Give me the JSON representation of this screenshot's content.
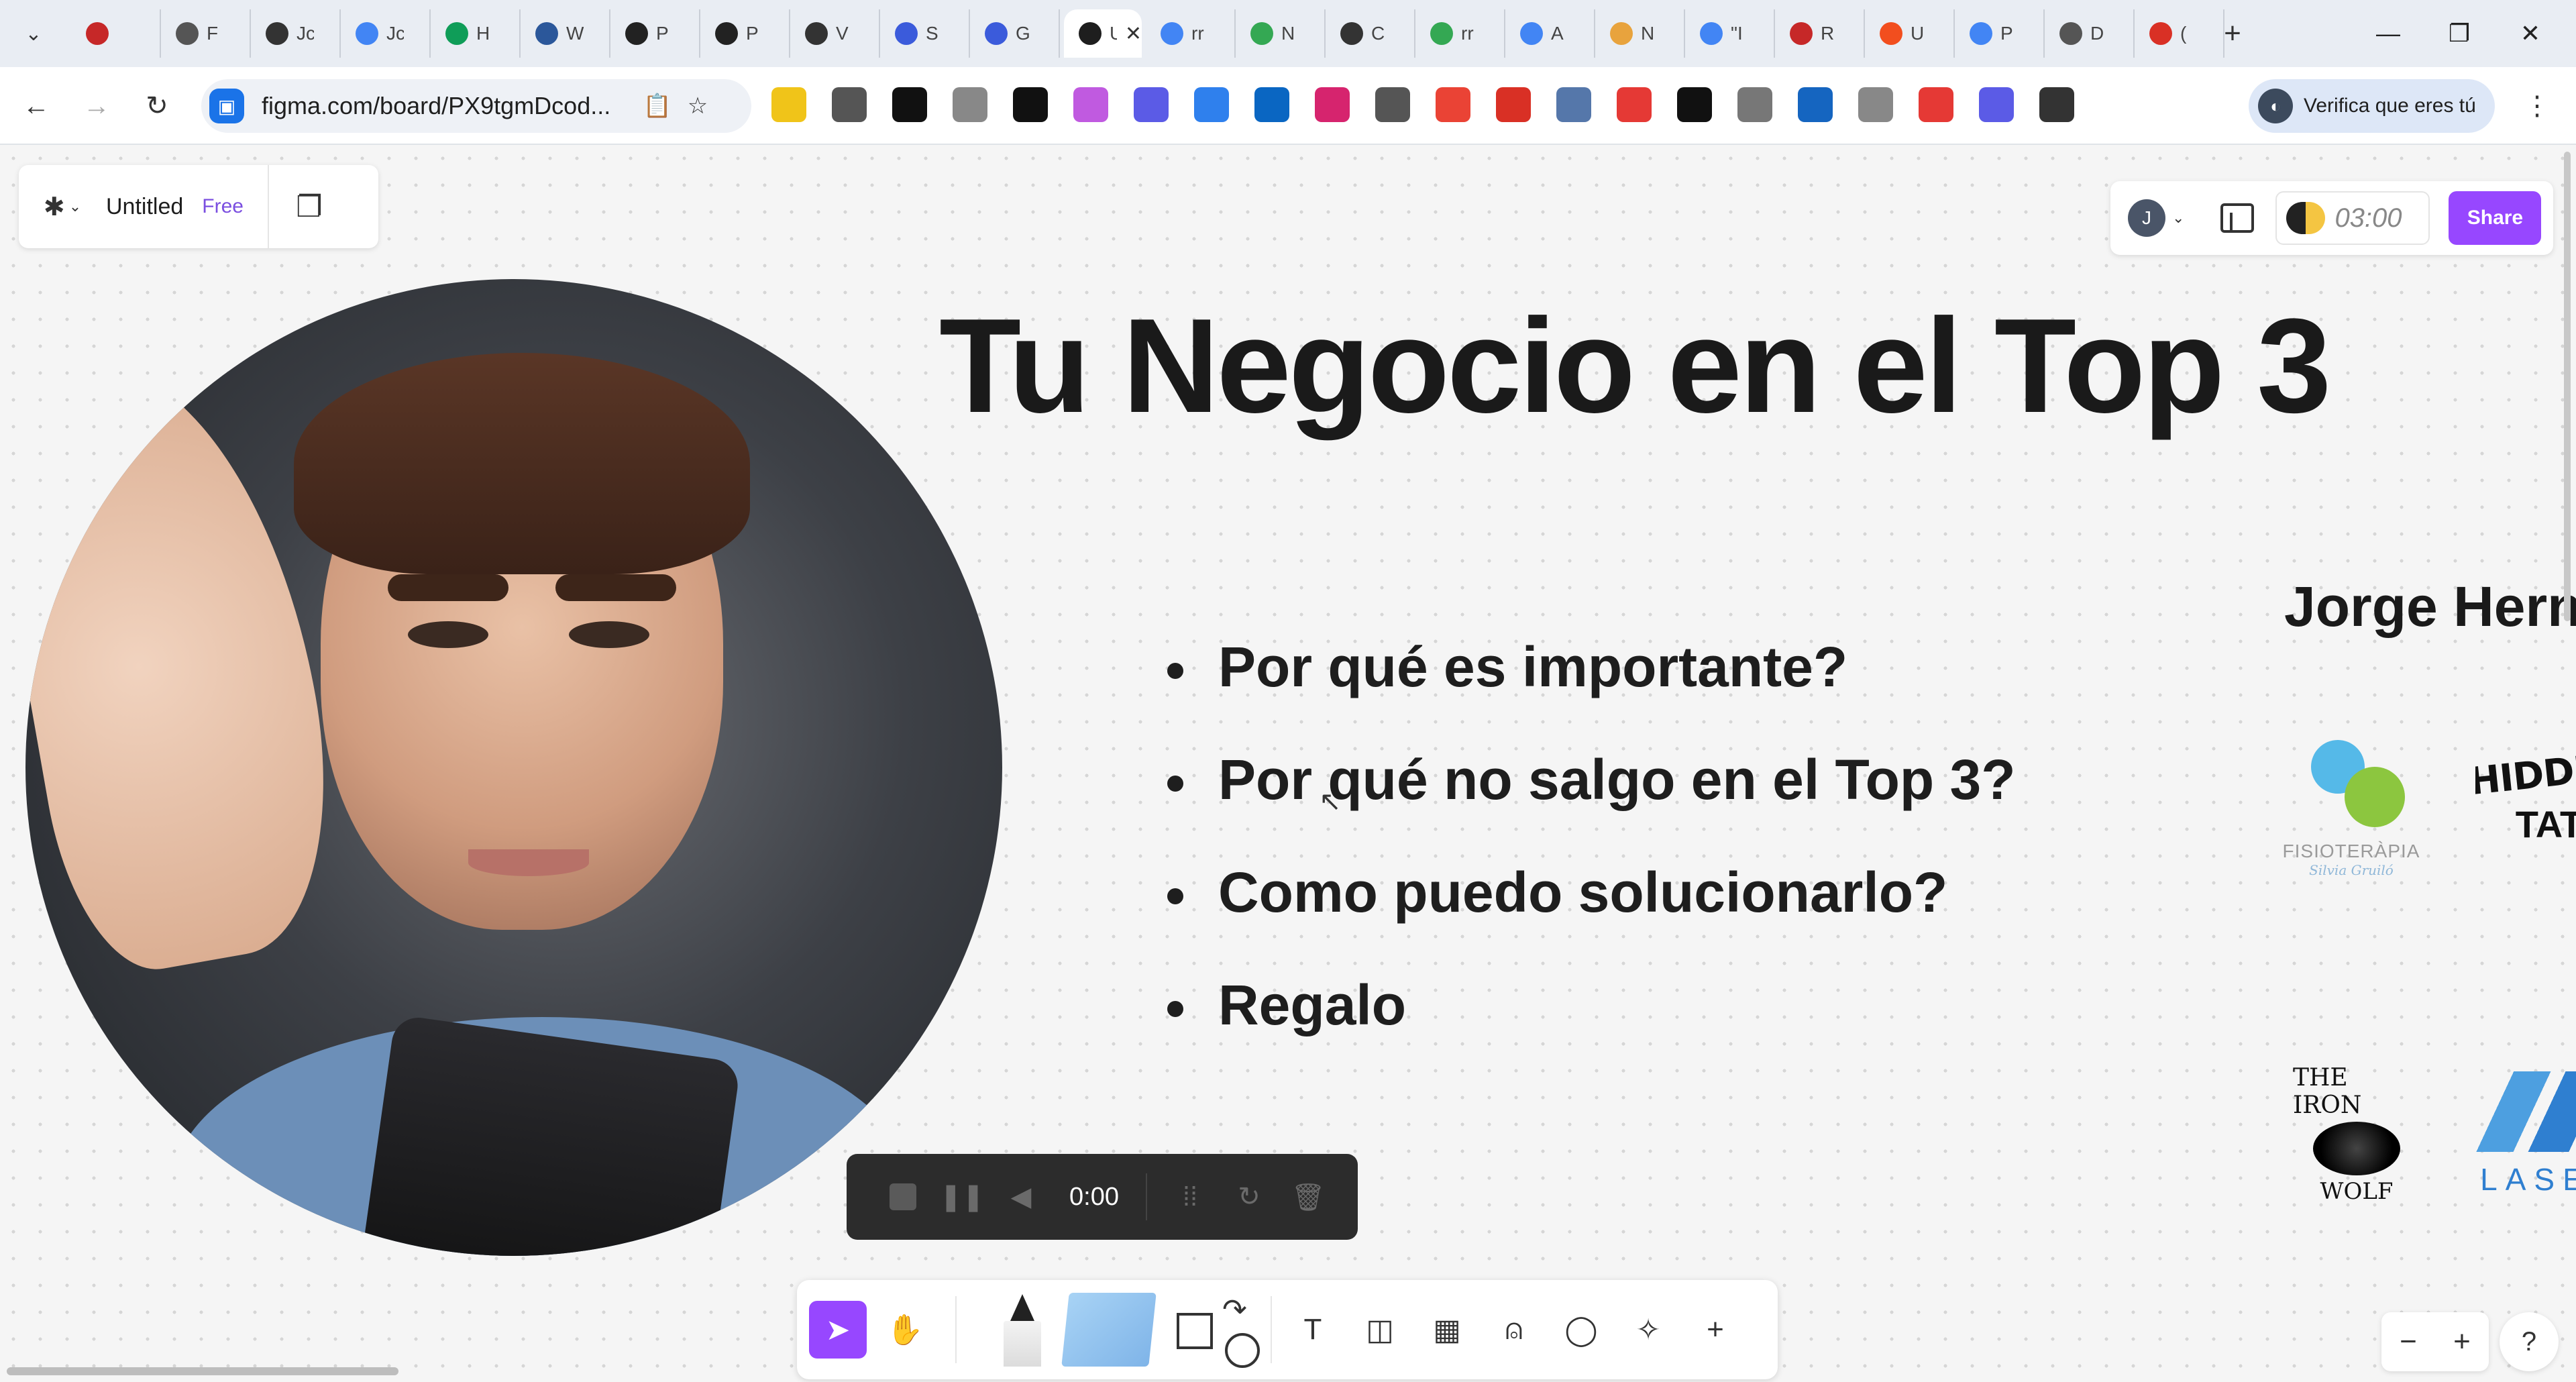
{
  "browser": {
    "tabs": [
      {
        "title": "",
        "favicon": "record-circle-icon",
        "color": "#c62828"
      },
      {
        "title": "F",
        "favicon": "cloud-icon",
        "color": "#555555"
      },
      {
        "title": "Jc",
        "favicon": "pen-icon",
        "color": "#333333"
      },
      {
        "title": "Jc",
        "favicon": "google-icon",
        "color": "#4285f4"
      },
      {
        "title": "H",
        "favicon": "sheets-icon",
        "color": "#0f9d58"
      },
      {
        "title": "W",
        "favicon": "word-icon",
        "color": "#2b579a"
      },
      {
        "title": "P",
        "favicon": "cube-icon",
        "color": "#222222"
      },
      {
        "title": "P",
        "favicon": "cube-icon",
        "color": "#222222"
      },
      {
        "title": "V",
        "favicon": "openai-icon",
        "color": "#333333"
      },
      {
        "title": "S",
        "favicon": "gear-flower-icon",
        "color": "#3b5bdb"
      },
      {
        "title": "G",
        "favicon": "gear-flower-icon",
        "color": "#3b5bdb"
      },
      {
        "title": "U",
        "favicon": "figma-icon",
        "color": "#ffffff",
        "active": true
      },
      {
        "title": "rr",
        "favicon": "google-icon",
        "color": "#4285f4"
      },
      {
        "title": "N",
        "favicon": "maps-pin-icon",
        "color": "#34a853"
      },
      {
        "title": "C",
        "favicon": "openai-icon",
        "color": "#333333"
      },
      {
        "title": "rr",
        "favicon": "maps-pin-icon",
        "color": "#34a853"
      },
      {
        "title": "A",
        "favicon": "sync-icon",
        "color": "#4285f4"
      },
      {
        "title": "N",
        "favicon": "check-badge-icon",
        "color": "#e8a33d"
      },
      {
        "title": "\"I",
        "favicon": "google-icon",
        "color": "#4285f4"
      },
      {
        "title": "R",
        "favicon": "squares-icon",
        "color": "#c62828"
      },
      {
        "title": "U",
        "favicon": "figma-icon",
        "color": "#f24e1e"
      },
      {
        "title": "P",
        "favicon": "google-icon",
        "color": "#4285f4"
      },
      {
        "title": "D",
        "favicon": "cloud-line-icon",
        "color": "#555555"
      },
      {
        "title": "(",
        "favicon": "maps-pin-icon",
        "color": "#d93025"
      }
    ],
    "active_tab_close": "✕",
    "new_tab": "+",
    "window_controls": {
      "minimize": "—",
      "maximize": "❐",
      "close": "✕"
    },
    "url": "figma.com/board/PX9tgmDcod...",
    "extensions": [
      "#f0c419",
      "#555555",
      "#111111",
      "#888888",
      "#111111",
      "#c05ae0",
      "#5b5be6",
      "#2f80ed",
      "#0a66c2",
      "#d6246e",
      "#555555",
      "#ea4335",
      "#d93025",
      "#5577aa",
      "#e53935",
      "#111111",
      "#777777",
      "#1565c0",
      "#888888",
      "#e53935",
      "#5b5be6",
      "#333333"
    ],
    "profile_button": "Verifica que eres tú"
  },
  "figma": {
    "file_name": "Untitled",
    "plan": "Free",
    "user_initial": "J",
    "timer": "03:00",
    "share_label": "Share",
    "accent": "#9747ff"
  },
  "slide": {
    "title": "Tu Negocio en el Top 3",
    "bullets": [
      "Por qué es importante?",
      "Por qué no salgo en el Top 3?",
      "Como puedo solucionarlo?",
      "Regalo"
    ],
    "presenter": "Jorge Herna",
    "logos": {
      "fisio_name": "FISIOTERÀPIA",
      "fisio_sub": "Silvia Gruiló",
      "hidden_top": "HIDDEN",
      "hidden_bottom": "TAT",
      "wolf_top": "THE IRON",
      "wolf_bottom": "WOLF",
      "laser": "LASE"
    }
  },
  "recorder": {
    "time": "0:00"
  },
  "tools": [
    "move",
    "hand",
    "marker",
    "sticky-note",
    "shapes",
    "text",
    "section",
    "table",
    "stamp",
    "comment",
    "ai-actions",
    "more"
  ],
  "zoom": {
    "out": "−",
    "in": "+"
  },
  "help": "?"
}
